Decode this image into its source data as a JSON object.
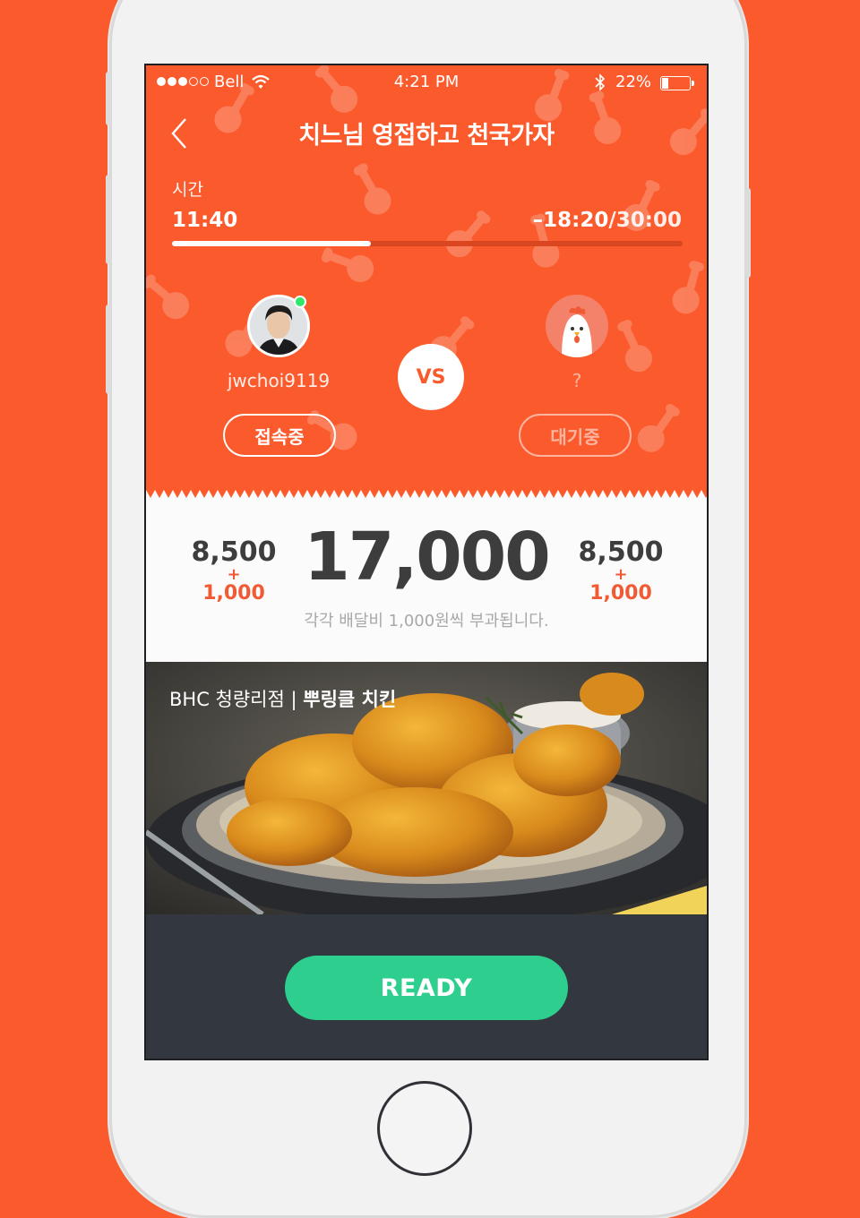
{
  "status_bar": {
    "carrier": "Bell",
    "time": "4:21 PM",
    "battery": "22%",
    "battery_level": 0.22,
    "signal_icon": "signal-dots-icon",
    "wifi_icon": "wifi-icon",
    "bluetooth_icon": "bluetooth-icon"
  },
  "nav": {
    "title": "치느님 영접하고 천국가자",
    "back_icon": "chevron-left-icon"
  },
  "timer": {
    "label": "시간",
    "elapsed": "11:40",
    "remaining": "–18:20",
    "total": "/30:00",
    "progress": 0.39
  },
  "players": {
    "me": {
      "username": "jwchoi9119",
      "status": "접속중",
      "online": true
    },
    "opponent": {
      "username": "?",
      "status": "대기중",
      "avatar_icon": "chicken-icon"
    },
    "vs_label": "VS"
  },
  "price": {
    "left_base": "8,500",
    "left_plus": "+",
    "left_fee": "1,000",
    "total": "17,000",
    "right_base": "8,500",
    "right_plus": "+",
    "right_fee": "1,000",
    "note": "각각 배달비 1,000원씩 부과됩니다."
  },
  "food": {
    "store": "BHC 청량리점 | ",
    "menu": "뿌링클 치킨"
  },
  "actions": {
    "ready_label": "READY"
  },
  "colors": {
    "accent": "#fb5a2c",
    "ready": "#2ecf8e",
    "online": "#2ee86a",
    "fee": "#f05a34",
    "bottom_bar": "#333740"
  }
}
